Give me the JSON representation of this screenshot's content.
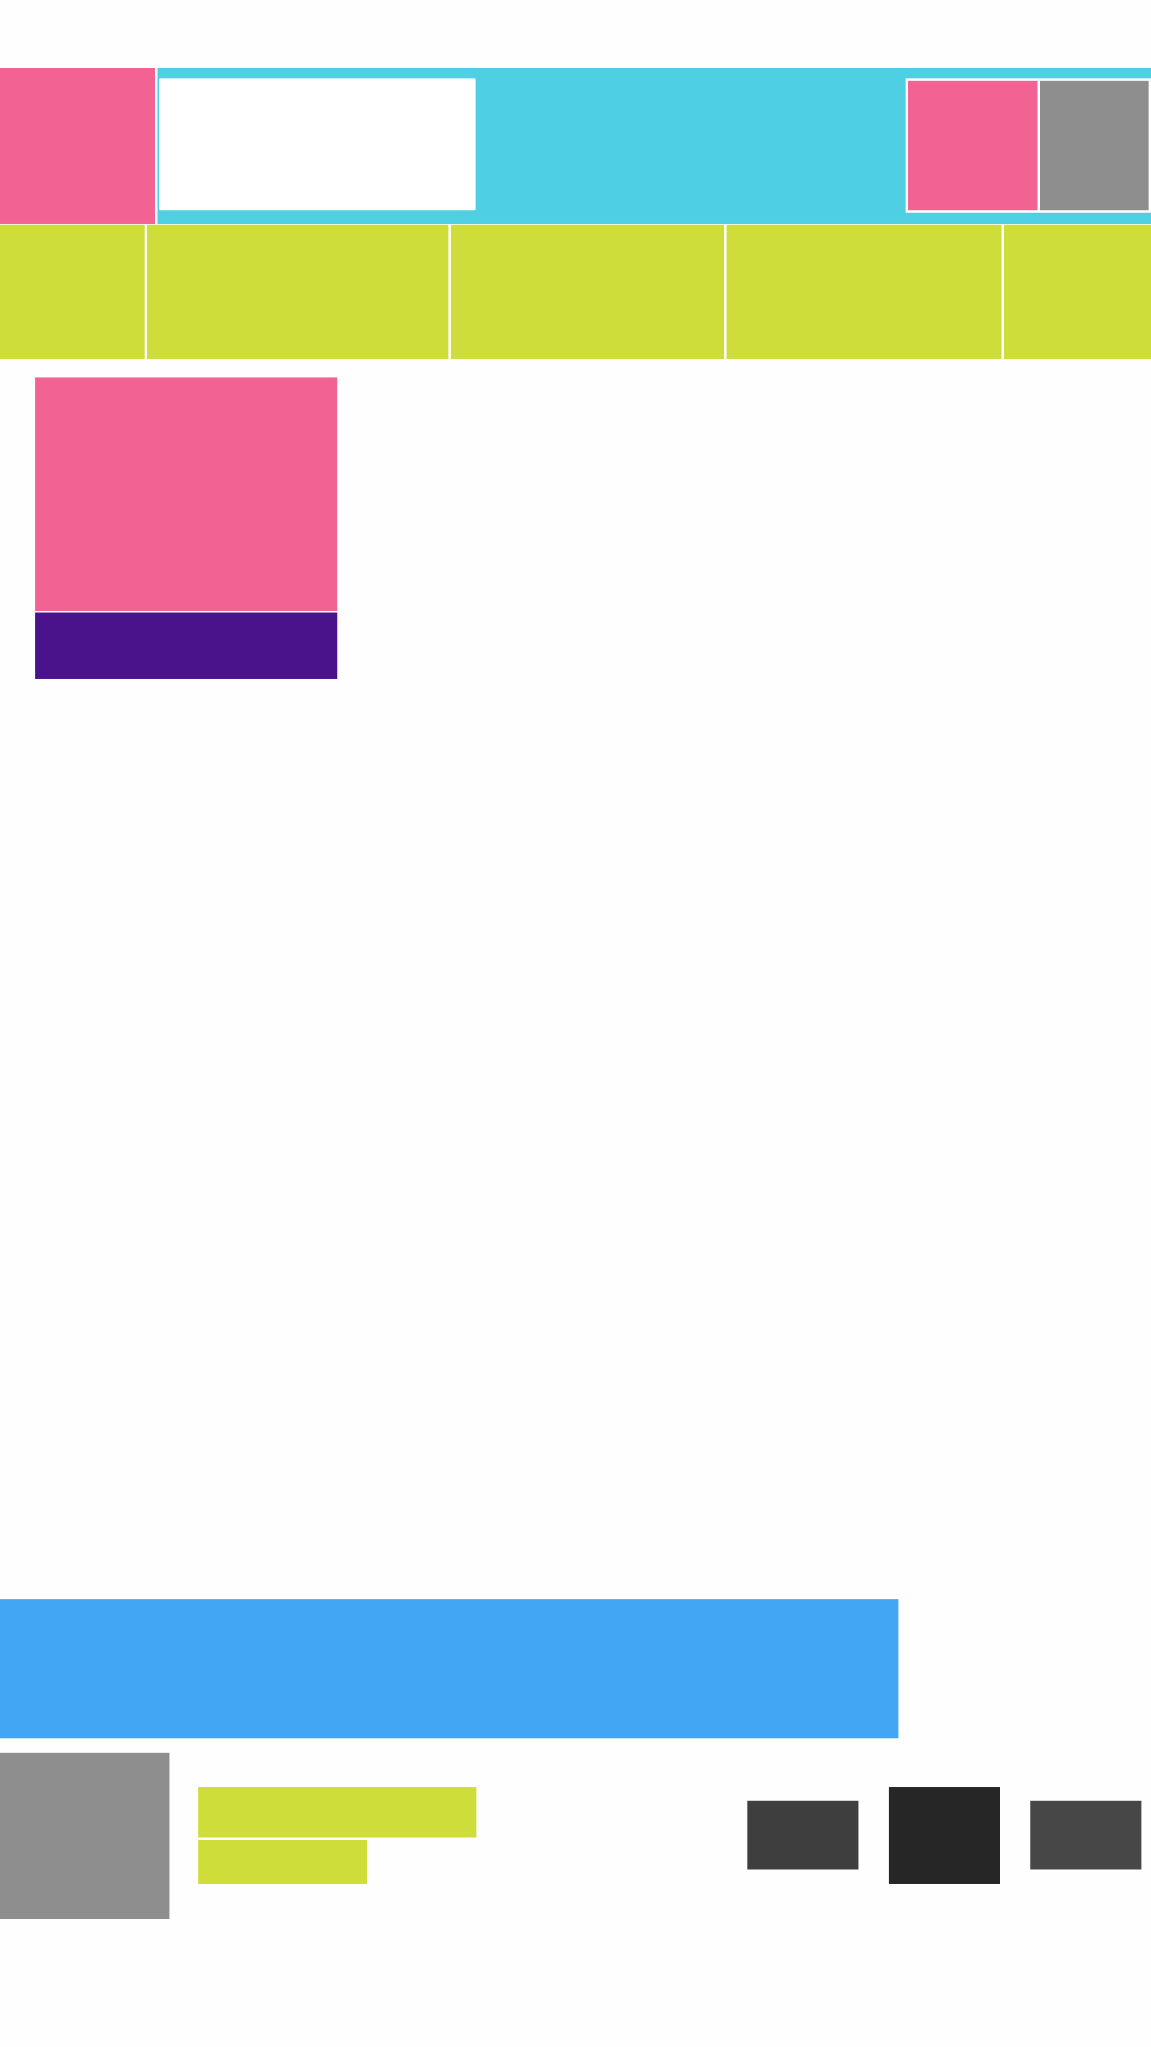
{
  "header": {
    "search": {
      "value": "",
      "placeholder": ""
    },
    "logo_icon": "app-logo-icon",
    "account_icon": "account-icon",
    "avatar_icon": "avatar-icon"
  },
  "nav": {
    "tabs": [
      {
        "label": ""
      },
      {
        "label": ""
      },
      {
        "label": ""
      },
      {
        "label": ""
      },
      {
        "label": ""
      }
    ]
  },
  "card": {
    "caption": ""
  },
  "banner": {
    "text": ""
  },
  "player": {
    "title": "",
    "artist": "",
    "prev_icon": "skip-previous-icon",
    "play_icon": "play-icon",
    "next_icon": "skip-next-icon"
  },
  "colors": {
    "header": "#4ecfe2",
    "accent_pink": "#f26393",
    "nav": "#cfdd3a",
    "caption": "#4a138c",
    "banner": "#43a6f5",
    "thumb": "#8e8e8e",
    "control_dark": "#262626"
  }
}
